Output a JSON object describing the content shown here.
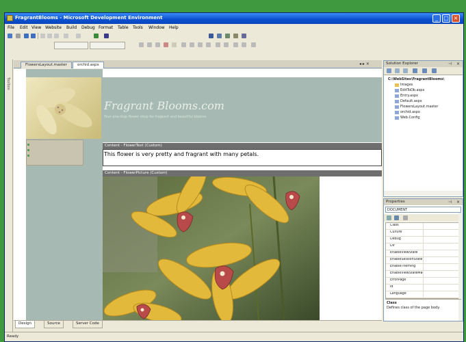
{
  "window": {
    "title": "FragrantBlooms - Microsoft Development Environment"
  },
  "menu": [
    "File",
    "Edit",
    "View",
    "Website",
    "Build",
    "Debug",
    "Format",
    "Table",
    "Tools",
    "Window",
    "Help"
  ],
  "tabs": [
    {
      "label": "FlowersLayout.master",
      "active": false
    },
    {
      "label": "orchid.aspx",
      "active": true
    }
  ],
  "left_tab": "Toolbox",
  "page": {
    "site_title": "Fragrant Blooms.com",
    "site_subtitle": "Your one-stop flower shop for fragrant and beautiful blooms",
    "content1_label": "Content - FlowerText (Custom)",
    "content1_text": "This flower is very pretty and fragrant with many petals.",
    "content2_label": "Content - FlowerPicture (Custom)"
  },
  "bottom_tabs": [
    {
      "label": "Design",
      "active": true
    },
    {
      "label": "Source",
      "active": false
    },
    {
      "label": "Server Code",
      "active": false
    }
  ],
  "status": "Ready",
  "solution_explorer": {
    "title": "Solution Explorer",
    "root": "C:\\WebSites\\FragrantBlooms\\",
    "items": [
      "Images",
      "EditToDb.aspx",
      "Entry.aspx",
      "Default.aspx",
      "FlowersLayout.master",
      "orchid.aspx",
      "Web.Config"
    ]
  },
  "properties": {
    "title": "Properties",
    "selected": "DOCUMENT",
    "rows": [
      "Class",
      "Culture",
      "Debug",
      "Dir",
      "EnableViewState",
      "EnableSessionState",
      "EnableTheming",
      "EnableViewStateMac",
      "ErrorPage",
      "Id",
      "Language"
    ],
    "desc_title": "Class",
    "desc_text": "Defines class of the page body."
  },
  "colors": {
    "titlebar": "#0b4fd0",
    "page_bg": "#a6b9b2",
    "content_bar": "#6e6e6e",
    "frame": "#3f9a3f"
  }
}
